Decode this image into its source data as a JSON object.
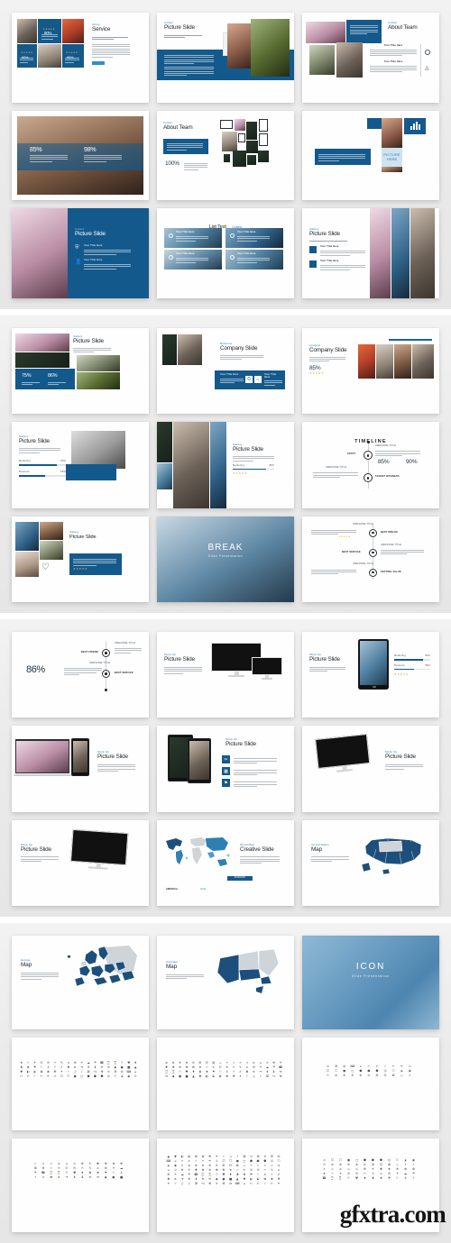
{
  "meta": {
    "watermark": "gfxtra.com",
    "accent_blue": "#14598c",
    "accent_light_blue": "#2d7fb8",
    "star_gold": "#e8b529",
    "background": "#ebebeb"
  },
  "panels": [
    {
      "id": "panel-1",
      "slides": [
        {
          "id": "s1",
          "kicker": "About",
          "title": "Service",
          "percents": [
            "90%",
            "90%",
            "90%",
            "90%"
          ],
          "stars": "★★★★★",
          "button": "Learn More"
        },
        {
          "id": "s2",
          "kicker": "Collect",
          "title": "Picture Slide"
        },
        {
          "id": "s3",
          "kicker": "Collect",
          "title": "About Team",
          "subtitles": [
            "Your Title Here",
            "Your Title Here"
          ]
        },
        {
          "id": "s4",
          "kicker": "",
          "title": "",
          "percents": [
            "85%",
            "98%"
          ]
        },
        {
          "id": "s5",
          "kicker": "Collect",
          "title": "About Team",
          "percents": [
            "100%"
          ]
        },
        {
          "id": "s6",
          "kicker": "",
          "title": "",
          "caption": "PICTURE HERE"
        },
        {
          "id": "s7",
          "kicker": "Collect",
          "title": "Picture Slide",
          "subtitles": [
            "Your Title Here",
            "Your Title Here"
          ]
        },
        {
          "id": "s8",
          "kicker": "Collect",
          "title": "List Text",
          "subtitles": [
            "Your Title Here",
            "Your Title Here",
            "Your Title Here",
            "Your Title Here"
          ]
        },
        {
          "id": "s9",
          "kicker": "Gallery",
          "title": "Picture Slide",
          "subtitles": [
            "Your Title Here",
            "Your Title Here"
          ]
        }
      ]
    },
    {
      "id": "panel-2",
      "slides": [
        {
          "id": "s10",
          "kicker": "Gallery",
          "title": "Picture Slide",
          "percents": [
            "75%",
            "86%"
          ]
        },
        {
          "id": "s11",
          "kicker": "Business",
          "title": "Company Slide",
          "subtitles": [
            "Your Title Here",
            "Your Title Here"
          ]
        },
        {
          "id": "s12",
          "kicker": "Analysis",
          "title": "Company Slide",
          "percents": [
            "85%"
          ],
          "stars": "★★★★★"
        },
        {
          "id": "s13",
          "kicker": "Gallery",
          "title": "Picture Slide",
          "bars": [
            {
              "label": "Marketing",
              "value": "80%"
            },
            {
              "label": "Business",
              "value": "55%"
            }
          ]
        },
        {
          "id": "s14",
          "kicker": "Gallery",
          "title": "Picture Slide",
          "bars": [
            {
              "label": "Marketing",
              "value": "80%"
            }
          ],
          "stars": "★★★★★"
        },
        {
          "id": "s15",
          "title": "TIMELINE",
          "nodes": [
            {
              "label": "START",
              "sub": "AWESOME TITLE"
            },
            {
              "label": "TARGET BUSINESS",
              "sub": "AWESOME TITLE"
            }
          ],
          "percents": [
            "85%",
            "90%"
          ]
        },
        {
          "id": "s16",
          "kicker": "Gallery",
          "title": "Picture Slide",
          "stars": "★★★★★"
        },
        {
          "id": "s17",
          "title": "BREAK",
          "subtitle": "Slide Presentation"
        },
        {
          "id": "s18",
          "nodes": [
            {
              "label": "BEST DREAM",
              "sub": "AWESOME TITLE"
            },
            {
              "label": "BEST SERVICE",
              "sub": "AWESOME TITLE"
            },
            {
              "label": "GETTING VALUE",
              "sub": "AWESOME TITLE"
            }
          ],
          "stars": "★★★★★"
        }
      ]
    },
    {
      "id": "panel-3",
      "slides": [
        {
          "id": "s19",
          "percents": [
            "86%"
          ],
          "nodes": [
            {
              "label": "BEST FRIEND",
              "sub": "AWESOME TITLE"
            },
            {
              "label": "BEST SERVICE",
              "sub": "AWESOME TITLE"
            }
          ]
        },
        {
          "id": "s20",
          "kicker": "Mock Up",
          "title": "Picture Slide"
        },
        {
          "id": "s21",
          "kicker": "Mock Up",
          "title": "Picture Slide",
          "bars": [
            {
              "label": "Marketing",
              "value": "80%"
            },
            {
              "label": "Business",
              "value": "55%"
            }
          ],
          "stars": "★★★★★"
        },
        {
          "id": "s22",
          "kicker": "Mock Up",
          "title": "Picture Slide"
        },
        {
          "id": "s23",
          "kicker": "Mock Up",
          "title": "Picture Slide"
        },
        {
          "id": "s24",
          "kicker": "Mock Up",
          "title": "Picture Slide"
        },
        {
          "id": "s25",
          "kicker": "Mock Up",
          "title": "Picture Slide"
        },
        {
          "id": "s26",
          "kicker": "World Map",
          "title": "Creative Slide",
          "legend": [
            "AMERICA",
            "ASIA",
            "EUROPE"
          ]
        },
        {
          "id": "s27",
          "kicker": "United States",
          "title": "Map"
        }
      ]
    },
    {
      "id": "panel-4",
      "slides": [
        {
          "id": "s28",
          "kicker": "Europe",
          "title": "Map"
        },
        {
          "id": "s29",
          "kicker": "Australia",
          "title": "Map"
        },
        {
          "id": "s30",
          "title": "ICON",
          "subtitle": "Slide Presentation"
        },
        {
          "id": "s31",
          "icon_rows": 4,
          "icon_cols": 18
        },
        {
          "id": "s32",
          "icon_rows": 4,
          "icon_cols": 18
        },
        {
          "id": "s33",
          "icon_rows": 3,
          "icon_cols": 11
        },
        {
          "id": "s34",
          "icon_rows": 4,
          "icon_cols": 12
        },
        {
          "id": "s35",
          "icon_rows": 7,
          "icon_cols": 17
        },
        {
          "id": "s36",
          "icon_rows": 5,
          "icon_cols": 12
        }
      ]
    }
  ],
  "icon_glyphs": [
    "★",
    "☆",
    "✈",
    "✆",
    "✉",
    "✂",
    "✎",
    "⌂",
    "⚙",
    "☀",
    "☁",
    "☂",
    "☎",
    "⌚",
    "⌛",
    "⏱",
    "♥",
    "♦",
    "♣",
    "♠",
    "⚑",
    "⚐",
    "⚓",
    "⚡",
    "✔",
    "✖",
    "➤",
    "➔",
    "⬆",
    "⬇",
    "⬅",
    "➡",
    "◆",
    "●",
    "■",
    "▲",
    "▼",
    "◐",
    "☯",
    "✿",
    "❀",
    "☘",
    "✦",
    "✧",
    "♫",
    "♪",
    "⌘",
    "⌥",
    "☢",
    "☣",
    "♻",
    "⚖",
    "⌨",
    "☕",
    "✄",
    "✍",
    "✓",
    "✏",
    "✒",
    "⚠",
    "☑",
    "☐",
    "◼",
    "◻",
    "⬟",
    "⬢",
    "⬣",
    "⌬",
    "⎔",
    "◈",
    "◉",
    "⊙",
    "⊚",
    "⊛",
    "⊕",
    "⊗",
    "⊘",
    "⊞",
    "⊟",
    "⊠",
    "⌯",
    "⌖",
    "⌗",
    "⍟",
    "⍉",
    "⎈",
    "⎉",
    "⎊",
    "✜",
    "✛",
    "✚",
    "❖",
    "❄",
    "❅",
    "❆"
  ]
}
